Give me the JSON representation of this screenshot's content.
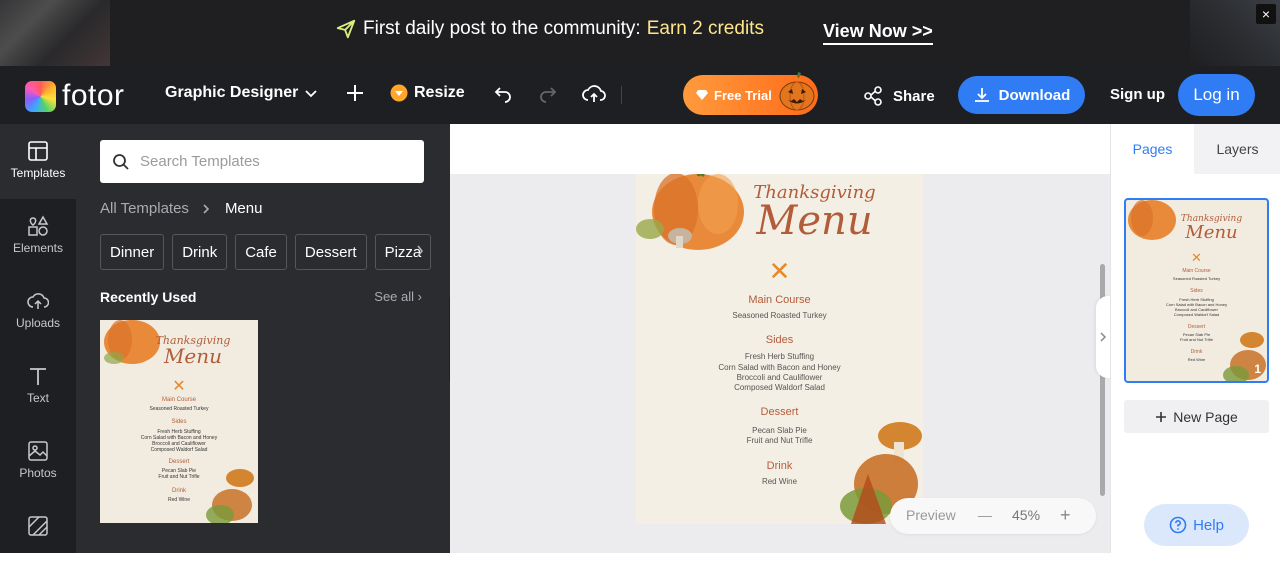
{
  "promo": {
    "text": "First daily post to the community:",
    "highlight": "Earn 2 credits",
    "cta": "View Now >>",
    "close": "×"
  },
  "topbar": {
    "logo": "fotor",
    "mode": "Graphic Designer",
    "resize": "Resize",
    "free_trial": "Free Trial",
    "share": "Share",
    "download": "Download",
    "signup": "Sign up",
    "login": "Log in"
  },
  "rail": [
    {
      "label": "Templates",
      "icon": "templates-icon"
    },
    {
      "label": "Elements",
      "icon": "elements-icon"
    },
    {
      "label": "Uploads",
      "icon": "uploads-icon"
    },
    {
      "label": "Text",
      "icon": "text-icon"
    },
    {
      "label": "Photos",
      "icon": "photos-icon"
    },
    {
      "label": "",
      "icon": "background-icon"
    }
  ],
  "panel": {
    "search_placeholder": "Search Templates",
    "crumb_root": "All Templates",
    "crumb_current": "Menu",
    "chips": [
      "Dinner",
      "Drink",
      "Cafe",
      "Dessert",
      "Pizza"
    ],
    "recent_title": "Recently Used",
    "see_all": "See all"
  },
  "menu": {
    "title_small": "Thanksgiving",
    "title_big": "Menu",
    "main_course_heading": "Main Course",
    "main_course_items": [
      "Seasoned Roasted Turkey"
    ],
    "sides_heading": "Sides",
    "sides_items": [
      "Fresh Herb Stuffing",
      "Corn Salad with Bacon and Honey",
      "Broccoli and Cauliflower",
      "Composed Waldorf Salad"
    ],
    "dessert_heading": "Dessert",
    "dessert_items": [
      "Pecan Slab Pie",
      "Fruit and Nut Trifle"
    ],
    "drink_heading": "Drink",
    "drink_items": [
      "Red Wine"
    ]
  },
  "canvas": {
    "preview": "Preview",
    "zoom": "45%",
    "minus": "—",
    "plus": "+"
  },
  "right": {
    "tab_pages": "Pages",
    "tab_layers": "Layers",
    "page_number": "1",
    "new_page": "New Page",
    "help": "Help"
  },
  "colors": {
    "accent": "#2f7cf5",
    "menu_text": "#b35c3a",
    "dark_bg": "#1e1f22",
    "panel_bg": "#2b2c30"
  }
}
